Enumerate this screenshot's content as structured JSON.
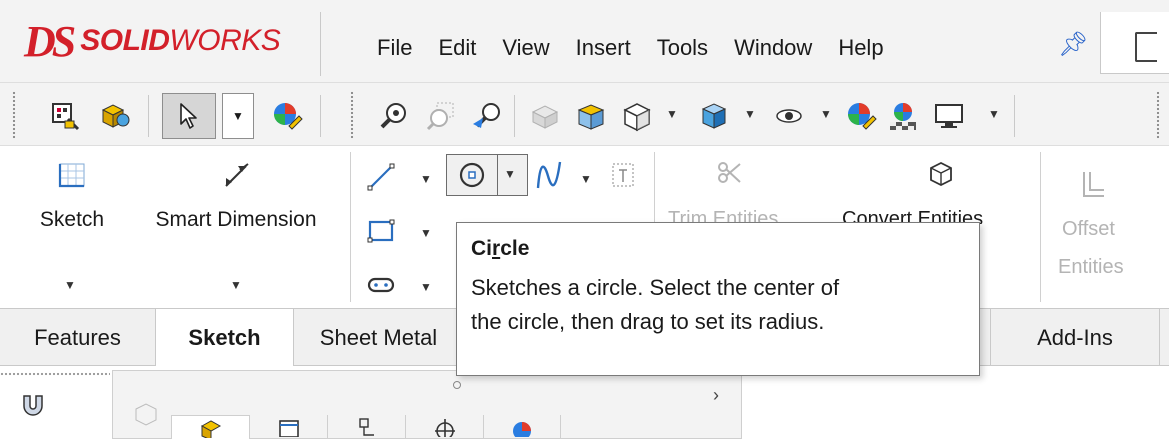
{
  "app": {
    "logo_ds": "DS",
    "logo_solid": "SOLID",
    "logo_works": "WORKS"
  },
  "menu": [
    "File",
    "Edit",
    "View",
    "Insert",
    "Tools",
    "Window",
    "Help"
  ],
  "ribbon": {
    "sketch_label": "Sketch",
    "smart_dimension_label": "Smart Dimension",
    "trim_entities_label": "Trim Entities",
    "convert_entities_label": "Convert Entities",
    "offset_label": "Offset",
    "entities_label": "Entities"
  },
  "tabs": [
    "Features",
    "Sketch",
    "Sheet Metal",
    "Add-Ins"
  ],
  "active_tab": "Sketch",
  "tooltip": {
    "title": "Circle",
    "title_mnemonic_index": 2,
    "line1": "Sketches a circle. Select the center of",
    "line2": "the circle, then drag to set its radius."
  },
  "colors": {
    "brand_red": "#d3202a",
    "pin_blue": "#2762c9",
    "toolbar_bg": "#f3f3f3"
  }
}
